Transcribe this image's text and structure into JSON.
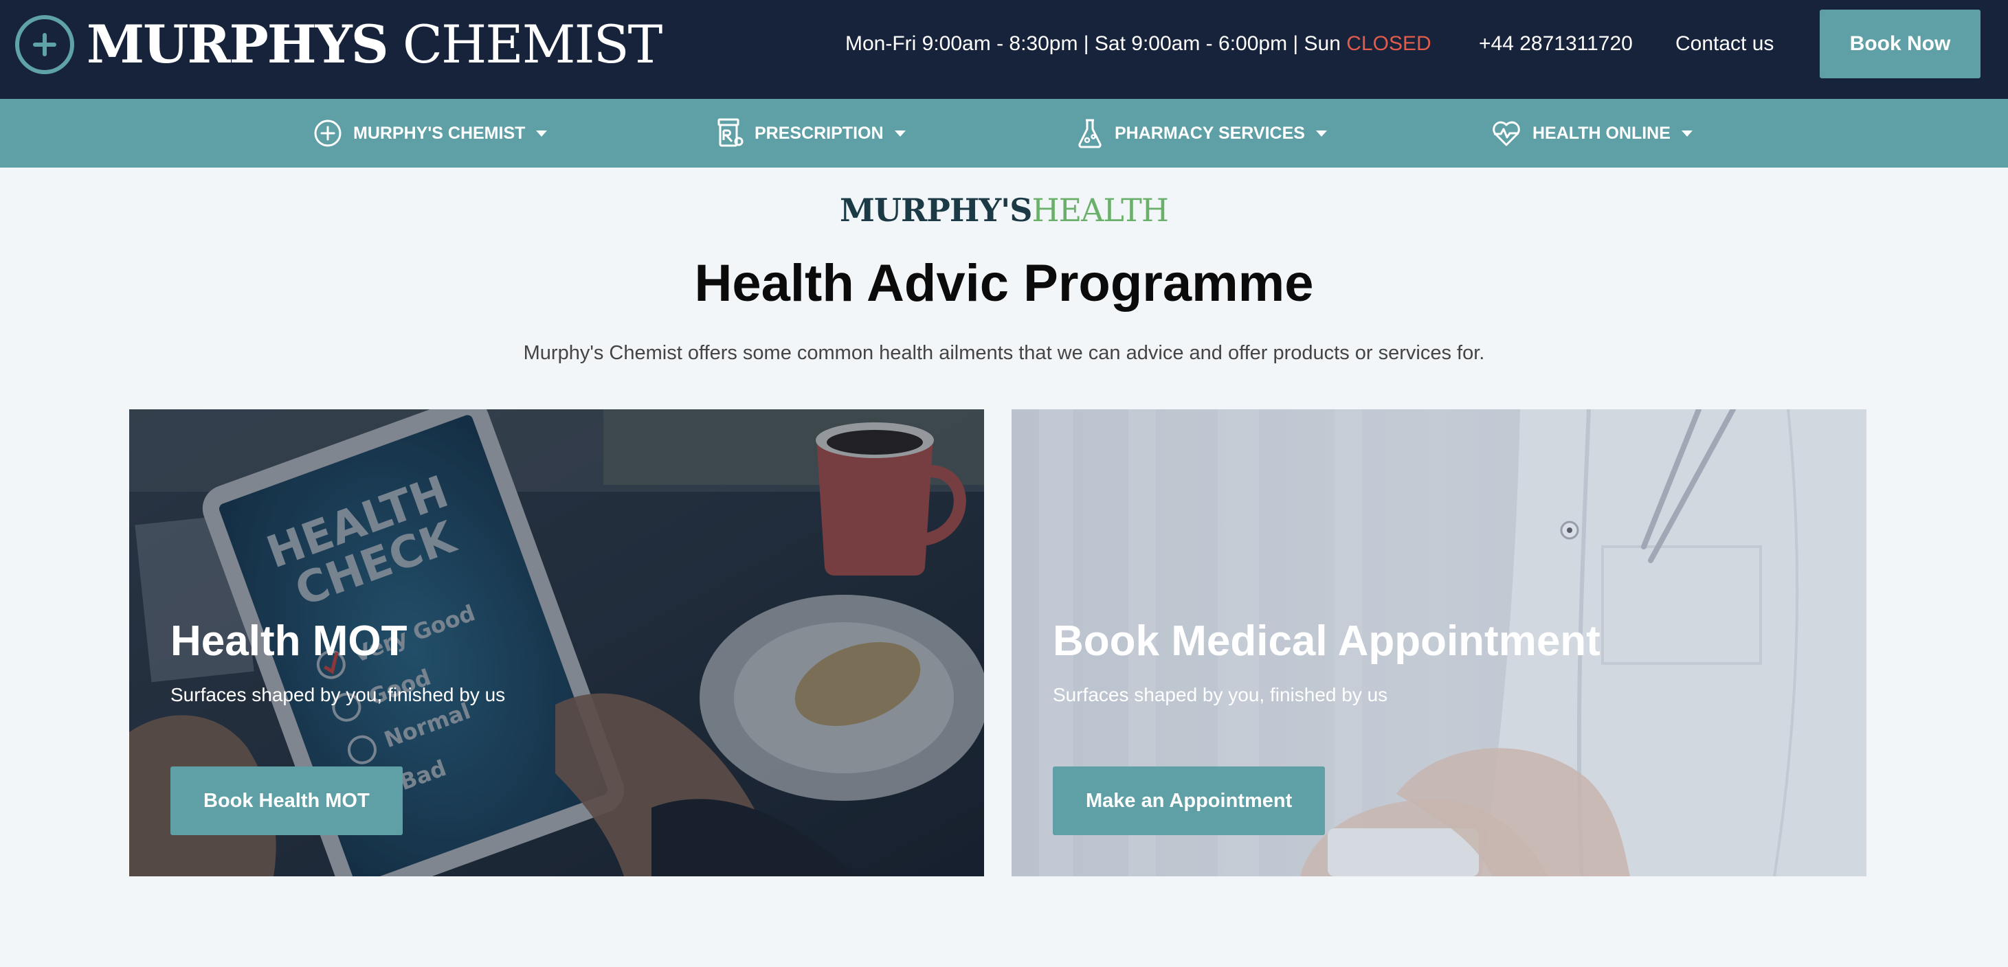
{
  "header": {
    "logo_bold": "MURPHYS",
    "logo_light": "CHEMIST",
    "hours_text": "Mon-Fri 9:00am - 8:30pm | Sat 9:00am - 6:00pm | Sun",
    "hours_closed": "CLOSED",
    "phone": "+44 2871311720",
    "contact_label": "Contact us",
    "book_now_label": "Book Now",
    "colors": {
      "bar": "#17233a",
      "accent": "#5f9fa6",
      "closed": "#e25c4b"
    }
  },
  "nav": {
    "items": [
      {
        "label": "MURPHY'S CHEMIST",
        "icon": "plus-circle-icon"
      },
      {
        "label": "PRESCRIPTION",
        "icon": "prescription-icon"
      },
      {
        "label": "PHARMACY SERVICES",
        "icon": "flask-icon"
      },
      {
        "label": "HEALTH ONLINE",
        "icon": "heartbeat-icon"
      }
    ]
  },
  "main": {
    "brand_part1": "MURPHY'S",
    "brand_part2": "HEALTH",
    "title": "Health Advic Programme",
    "subtitle": "Murphy's Chemist offers some common health ailments that we can advice and offer products or services for."
  },
  "cards": [
    {
      "title": "Health MOT",
      "subtitle": "Surfaces shaped by you, finished by us",
      "button_label": "Book Health MOT",
      "image_text": {
        "heading_line1": "HEALTH",
        "heading_line2": "CHECK",
        "options": [
          "Very Good",
          "Good",
          "Normal",
          "Bad"
        ]
      }
    },
    {
      "title": "Book Medical Appointment",
      "subtitle": "Surfaces shaped by you, finished by us",
      "button_label": "Make an Appointment"
    }
  ]
}
